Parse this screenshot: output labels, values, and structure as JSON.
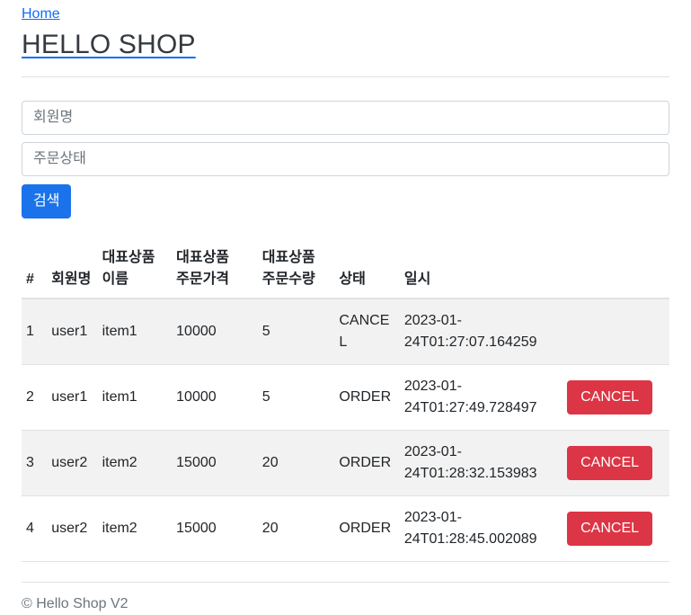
{
  "header": {
    "home_link": "Home",
    "shop_title": "HELLO SHOP"
  },
  "search": {
    "member_placeholder": "회원명",
    "member_value": "",
    "status_placeholder": "주문상태",
    "status_value": "",
    "submit_label": "검색"
  },
  "table": {
    "columns": [
      "#",
      "회원명",
      "대표상품 이름",
      "대표상품 주문가격",
      "대표상품 주문수량",
      "상태",
      "일시",
      ""
    ],
    "rows": [
      {
        "num": "1",
        "member": "user1",
        "item": "item1",
        "price": "10000",
        "count": "5",
        "status": "CANCEL",
        "date": "2023-01-24T01:27:07.164259",
        "action": ""
      },
      {
        "num": "2",
        "member": "user1",
        "item": "item1",
        "price": "10000",
        "count": "5",
        "status": "ORDER",
        "date": "2023-01-24T01:27:49.728497",
        "action": "CANCEL"
      },
      {
        "num": "3",
        "member": "user2",
        "item": "item2",
        "price": "15000",
        "count": "20",
        "status": "ORDER",
        "date": "2023-01-24T01:28:32.153983",
        "action": "CANCEL"
      },
      {
        "num": "4",
        "member": "user2",
        "item": "item2",
        "price": "15000",
        "count": "20",
        "status": "ORDER",
        "date": "2023-01-24T01:28:45.002089",
        "action": "CANCEL"
      }
    ]
  },
  "footer": {
    "copyright": "© Hello Shop V2"
  },
  "colors": {
    "link": "#0d6efd",
    "primary": "#1a73ea",
    "danger": "#dc3545",
    "muted": "#6c757d",
    "stripe": "#f2f2f2",
    "border": "#dee2e6"
  }
}
